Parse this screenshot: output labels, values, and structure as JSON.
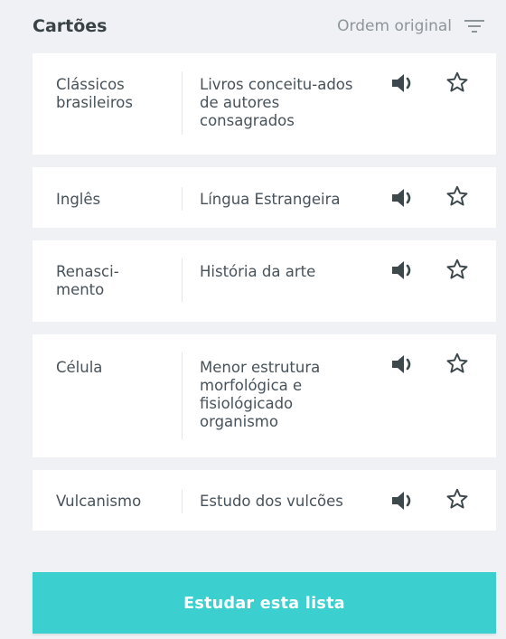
{
  "header": {
    "title": "Cartões",
    "sort_label": "Ordem original",
    "sort_icon": "filter-lines-icon"
  },
  "cards": [
    {
      "term": "Clássicos brasileiros",
      "definition": "Livros conceitu-ados de autores consagrados",
      "audio_icon": "speaker-icon",
      "star_icon": "star-outline-icon"
    },
    {
      "term": "Inglês",
      "definition": "Língua Estrangeira",
      "audio_icon": "speaker-icon",
      "star_icon": "star-outline-icon"
    },
    {
      "term": "Renasci-mento",
      "definition": "História da arte",
      "audio_icon": "speaker-icon",
      "star_icon": "star-outline-icon"
    },
    {
      "term": "Célula",
      "definition": "Menor estrutura morfológica e fisiológicado organismo",
      "audio_icon": "speaker-icon",
      "star_icon": "star-outline-icon"
    },
    {
      "term": "Vulcanismo",
      "definition": "Estudo dos vulcões",
      "audio_icon": "speaker-icon",
      "star_icon": "star-outline-icon"
    }
  ],
  "footer": {
    "study_button_label": "Estudar esta lista"
  },
  "colors": {
    "background": "#f0f1f5",
    "card": "#ffffff",
    "accent": "#3ccfcf",
    "text": "#47525a",
    "muted": "#8d9599",
    "icon": "#3d484d"
  }
}
